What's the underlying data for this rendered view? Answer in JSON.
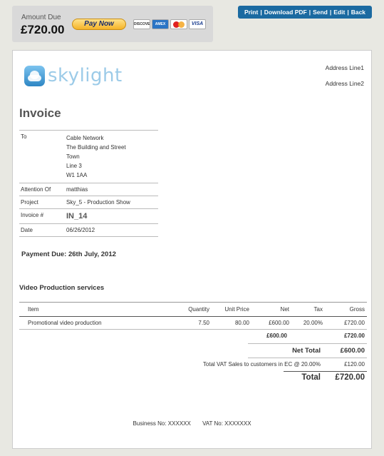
{
  "summary": {
    "amount_due_label": "Amount Due",
    "amount_due_value": "£720.00",
    "pay_now_label": "Pay Now",
    "cards": [
      "DISCOVER",
      "AMERICAN EXPRESS",
      "MasterCard",
      "VISA"
    ]
  },
  "actions": [
    "Print",
    "Download PDF",
    "Send",
    "Edit",
    "Back"
  ],
  "company": {
    "logo_text": "skylight",
    "address_line1": "Address Line1",
    "address_line2": "Address Line2"
  },
  "invoice": {
    "title": "Invoice",
    "to_label": "To",
    "to_lines": [
      "Cable Network",
      "The Building and Street",
      "Town",
      "Line 3",
      "W1 1AA"
    ],
    "attention_label": "Attention Of",
    "attention_value": "matthias",
    "project_label": "Project",
    "project_value": "Sky_5 - Production Show",
    "number_label": "Invoice #",
    "number_value": "IN_14",
    "date_label": "Date",
    "date_value": "06/26/2012",
    "payment_due": "Payment Due: 26th July, 2012"
  },
  "items": {
    "section_title": "Video Production services",
    "headers": [
      "Item",
      "Quantity",
      "Unit Price",
      "Net",
      "Tax",
      "Gross"
    ],
    "rows": [
      [
        "Promotional video production",
        "7.50",
        "80.00",
        "£600.00",
        "20.00%",
        "£720.00"
      ]
    ],
    "subtotal_net": "£600.00",
    "subtotal_gross": "£720.00",
    "net_total_label": "Net Total",
    "net_total_value": "£600.00",
    "vat_label": "Total VAT Sales to customers in EC @ 20.00%",
    "vat_value": "£120.00",
    "total_label": "Total",
    "total_value": "£720.00"
  },
  "footer": {
    "business_no": "Business No: XXXXXX",
    "vat_no": "VAT No: XXXXXXX"
  }
}
